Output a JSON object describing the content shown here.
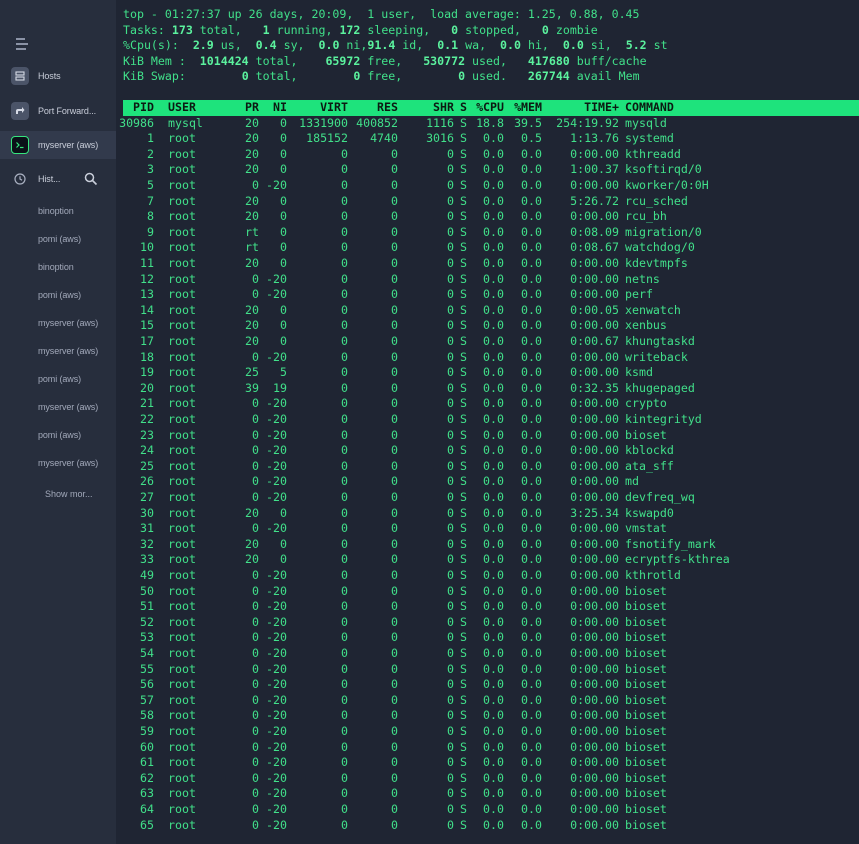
{
  "sidebar": {
    "nav": [
      {
        "label": "Hosts",
        "icon": "server-icon"
      },
      {
        "label": "Port Forward...",
        "icon": "arrow-icon"
      },
      {
        "label": "myserver (aws)",
        "icon": "terminal-icon"
      },
      {
        "label": "Hist...",
        "icon": "history-icon"
      }
    ],
    "history": [
      "binoption",
      "pomi (aws)",
      "binoption",
      "pomi (aws)",
      "myserver (aws)",
      "myserver (aws)",
      "pomi (aws)",
      "myserver (aws)",
      "pomi (aws)",
      "myserver (aws)"
    ],
    "show_more": "Show mor..."
  },
  "top_summary": {
    "line1": "top - 01:27:37 up 26 days, 20:09,  1 user,  load average: 1.25, 0.88, 0.45",
    "tasks": {
      "label": "Tasks:",
      "total": "173",
      "total_label": " total,   ",
      "running": "1",
      "running_label": " running, ",
      "sleeping": "172",
      "sleeping_label": " sleeping,   ",
      "stopped": "0",
      "stopped_label": " stopped,   ",
      "zombie": "0",
      "zombie_label": " zombie"
    },
    "cpu": {
      "label": "%Cpu(s):  ",
      "us": "2.9",
      "sy": "0.4",
      "ni": "0.0",
      "id": "91.4",
      "wa": "0.1",
      "hi": "0.0",
      "si": "0.0",
      "st": "5.2"
    },
    "mem": {
      "label": "KiB Mem : ",
      "total": "1014424",
      "free": "65972",
      "used": "530772",
      "buff": "417680"
    },
    "swap": {
      "label": "KiB Swap: ",
      "total": "0",
      "free": "0",
      "used": "0",
      "avail": "267744"
    }
  },
  "columns": [
    "PID",
    "USER",
    "PR",
    "NI",
    "VIRT",
    "RES",
    "SHR",
    "S",
    "%CPU",
    "%MEM",
    "TIME+",
    "COMMAND"
  ],
  "processes": [
    [
      "30986",
      "mysql",
      "20",
      "0",
      "1331900",
      "400852",
      "1116",
      "S",
      "18.8",
      "39.5",
      "254:19.92",
      "mysqld"
    ],
    [
      "1",
      "root",
      "20",
      "0",
      "185152",
      "4740",
      "3016",
      "S",
      "0.0",
      "0.5",
      "1:13.76",
      "systemd"
    ],
    [
      "2",
      "root",
      "20",
      "0",
      "0",
      "0",
      "0",
      "S",
      "0.0",
      "0.0",
      "0:00.00",
      "kthreadd"
    ],
    [
      "3",
      "root",
      "20",
      "0",
      "0",
      "0",
      "0",
      "S",
      "0.0",
      "0.0",
      "1:00.37",
      "ksoftirqd/0"
    ],
    [
      "5",
      "root",
      "0",
      "-20",
      "0",
      "0",
      "0",
      "S",
      "0.0",
      "0.0",
      "0:00.00",
      "kworker/0:0H"
    ],
    [
      "7",
      "root",
      "20",
      "0",
      "0",
      "0",
      "0",
      "S",
      "0.0",
      "0.0",
      "5:26.72",
      "rcu_sched"
    ],
    [
      "8",
      "root",
      "20",
      "0",
      "0",
      "0",
      "0",
      "S",
      "0.0",
      "0.0",
      "0:00.00",
      "rcu_bh"
    ],
    [
      "9",
      "root",
      "rt",
      "0",
      "0",
      "0",
      "0",
      "S",
      "0.0",
      "0.0",
      "0:08.09",
      "migration/0"
    ],
    [
      "10",
      "root",
      "rt",
      "0",
      "0",
      "0",
      "0",
      "S",
      "0.0",
      "0.0",
      "0:08.67",
      "watchdog/0"
    ],
    [
      "11",
      "root",
      "20",
      "0",
      "0",
      "0",
      "0",
      "S",
      "0.0",
      "0.0",
      "0:00.00",
      "kdevtmpfs"
    ],
    [
      "12",
      "root",
      "0",
      "-20",
      "0",
      "0",
      "0",
      "S",
      "0.0",
      "0.0",
      "0:00.00",
      "netns"
    ],
    [
      "13",
      "root",
      "0",
      "-20",
      "0",
      "0",
      "0",
      "S",
      "0.0",
      "0.0",
      "0:00.00",
      "perf"
    ],
    [
      "14",
      "root",
      "20",
      "0",
      "0",
      "0",
      "0",
      "S",
      "0.0",
      "0.0",
      "0:00.05",
      "xenwatch"
    ],
    [
      "15",
      "root",
      "20",
      "0",
      "0",
      "0",
      "0",
      "S",
      "0.0",
      "0.0",
      "0:00.00",
      "xenbus"
    ],
    [
      "17",
      "root",
      "20",
      "0",
      "0",
      "0",
      "0",
      "S",
      "0.0",
      "0.0",
      "0:00.67",
      "khungtaskd"
    ],
    [
      "18",
      "root",
      "0",
      "-20",
      "0",
      "0",
      "0",
      "S",
      "0.0",
      "0.0",
      "0:00.00",
      "writeback"
    ],
    [
      "19",
      "root",
      "25",
      "5",
      "0",
      "0",
      "0",
      "S",
      "0.0",
      "0.0",
      "0:00.00",
      "ksmd"
    ],
    [
      "20",
      "root",
      "39",
      "19",
      "0",
      "0",
      "0",
      "S",
      "0.0",
      "0.0",
      "0:32.35",
      "khugepaged"
    ],
    [
      "21",
      "root",
      "0",
      "-20",
      "0",
      "0",
      "0",
      "S",
      "0.0",
      "0.0",
      "0:00.00",
      "crypto"
    ],
    [
      "22",
      "root",
      "0",
      "-20",
      "0",
      "0",
      "0",
      "S",
      "0.0",
      "0.0",
      "0:00.00",
      "kintegrityd"
    ],
    [
      "23",
      "root",
      "0",
      "-20",
      "0",
      "0",
      "0",
      "S",
      "0.0",
      "0.0",
      "0:00.00",
      "bioset"
    ],
    [
      "24",
      "root",
      "0",
      "-20",
      "0",
      "0",
      "0",
      "S",
      "0.0",
      "0.0",
      "0:00.00",
      "kblockd"
    ],
    [
      "25",
      "root",
      "0",
      "-20",
      "0",
      "0",
      "0",
      "S",
      "0.0",
      "0.0",
      "0:00.00",
      "ata_sff"
    ],
    [
      "26",
      "root",
      "0",
      "-20",
      "0",
      "0",
      "0",
      "S",
      "0.0",
      "0.0",
      "0:00.00",
      "md"
    ],
    [
      "27",
      "root",
      "0",
      "-20",
      "0",
      "0",
      "0",
      "S",
      "0.0",
      "0.0",
      "0:00.00",
      "devfreq_wq"
    ],
    [
      "30",
      "root",
      "20",
      "0",
      "0",
      "0",
      "0",
      "S",
      "0.0",
      "0.0",
      "3:25.34",
      "kswapd0"
    ],
    [
      "31",
      "root",
      "0",
      "-20",
      "0",
      "0",
      "0",
      "S",
      "0.0",
      "0.0",
      "0:00.00",
      "vmstat"
    ],
    [
      "32",
      "root",
      "20",
      "0",
      "0",
      "0",
      "0",
      "S",
      "0.0",
      "0.0",
      "0:00.00",
      "fsnotify_mark"
    ],
    [
      "33",
      "root",
      "20",
      "0",
      "0",
      "0",
      "0",
      "S",
      "0.0",
      "0.0",
      "0:00.00",
      "ecryptfs-kthrea"
    ],
    [
      "49",
      "root",
      "0",
      "-20",
      "0",
      "0",
      "0",
      "S",
      "0.0",
      "0.0",
      "0:00.00",
      "kthrotld"
    ],
    [
      "50",
      "root",
      "0",
      "-20",
      "0",
      "0",
      "0",
      "S",
      "0.0",
      "0.0",
      "0:00.00",
      "bioset"
    ],
    [
      "51",
      "root",
      "0",
      "-20",
      "0",
      "0",
      "0",
      "S",
      "0.0",
      "0.0",
      "0:00.00",
      "bioset"
    ],
    [
      "52",
      "root",
      "0",
      "-20",
      "0",
      "0",
      "0",
      "S",
      "0.0",
      "0.0",
      "0:00.00",
      "bioset"
    ],
    [
      "53",
      "root",
      "0",
      "-20",
      "0",
      "0",
      "0",
      "S",
      "0.0",
      "0.0",
      "0:00.00",
      "bioset"
    ],
    [
      "54",
      "root",
      "0",
      "-20",
      "0",
      "0",
      "0",
      "S",
      "0.0",
      "0.0",
      "0:00.00",
      "bioset"
    ],
    [
      "55",
      "root",
      "0",
      "-20",
      "0",
      "0",
      "0",
      "S",
      "0.0",
      "0.0",
      "0:00.00",
      "bioset"
    ],
    [
      "56",
      "root",
      "0",
      "-20",
      "0",
      "0",
      "0",
      "S",
      "0.0",
      "0.0",
      "0:00.00",
      "bioset"
    ],
    [
      "57",
      "root",
      "0",
      "-20",
      "0",
      "0",
      "0",
      "S",
      "0.0",
      "0.0",
      "0:00.00",
      "bioset"
    ],
    [
      "58",
      "root",
      "0",
      "-20",
      "0",
      "0",
      "0",
      "S",
      "0.0",
      "0.0",
      "0:00.00",
      "bioset"
    ],
    [
      "59",
      "root",
      "0",
      "-20",
      "0",
      "0",
      "0",
      "S",
      "0.0",
      "0.0",
      "0:00.00",
      "bioset"
    ],
    [
      "60",
      "root",
      "0",
      "-20",
      "0",
      "0",
      "0",
      "S",
      "0.0",
      "0.0",
      "0:00.00",
      "bioset"
    ],
    [
      "61",
      "root",
      "0",
      "-20",
      "0",
      "0",
      "0",
      "S",
      "0.0",
      "0.0",
      "0:00.00",
      "bioset"
    ],
    [
      "62",
      "root",
      "0",
      "-20",
      "0",
      "0",
      "0",
      "S",
      "0.0",
      "0.0",
      "0:00.00",
      "bioset"
    ],
    [
      "63",
      "root",
      "0",
      "-20",
      "0",
      "0",
      "0",
      "S",
      "0.0",
      "0.0",
      "0:00.00",
      "bioset"
    ],
    [
      "64",
      "root",
      "0",
      "-20",
      "0",
      "0",
      "0",
      "S",
      "0.0",
      "0.0",
      "0:00.00",
      "bioset"
    ],
    [
      "65",
      "root",
      "0",
      "-20",
      "0",
      "0",
      "0",
      "S",
      "0.0",
      "0.0",
      "0:00.00",
      "bioset"
    ]
  ],
  "colors": {
    "terminal_text": "#41e08a",
    "header_bar": "#1ee37c",
    "sidebar_bg": "#272e3d",
    "terminal_bg": "#1f2533"
  }
}
